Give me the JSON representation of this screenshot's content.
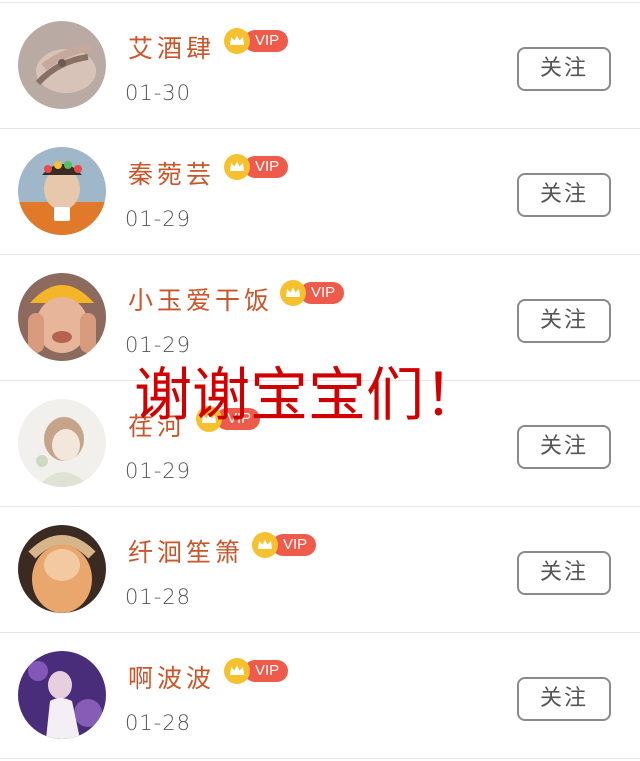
{
  "follow_list": {
    "items": [
      {
        "name": "艾酒肆",
        "date": "01-30",
        "badge": "VIP",
        "button": "关注"
      },
      {
        "name": "秦菀芸",
        "date": "01-29",
        "badge": "VIP",
        "button": "关注"
      },
      {
        "name": "小玉爱干饭",
        "date": "01-29",
        "badge": "VIP",
        "button": "关注"
      },
      {
        "name": "荏河",
        "date": "01-29",
        "badge": "VIP",
        "button": "关注"
      },
      {
        "name": "纤洄笙箫",
        "date": "01-28",
        "badge": "VIP",
        "button": "关注"
      },
      {
        "name": "啊波波",
        "date": "01-28",
        "badge": "VIP",
        "button": "关注"
      }
    ]
  },
  "overlay": {
    "text": "谢谢宝宝们！"
  },
  "colors": {
    "name_text": "#c9562a",
    "vip_pill": "#ee5b4b",
    "crown_bg": "#f5c12e",
    "overlay_text": "#d10000",
    "button_border": "#8a8a8a"
  }
}
